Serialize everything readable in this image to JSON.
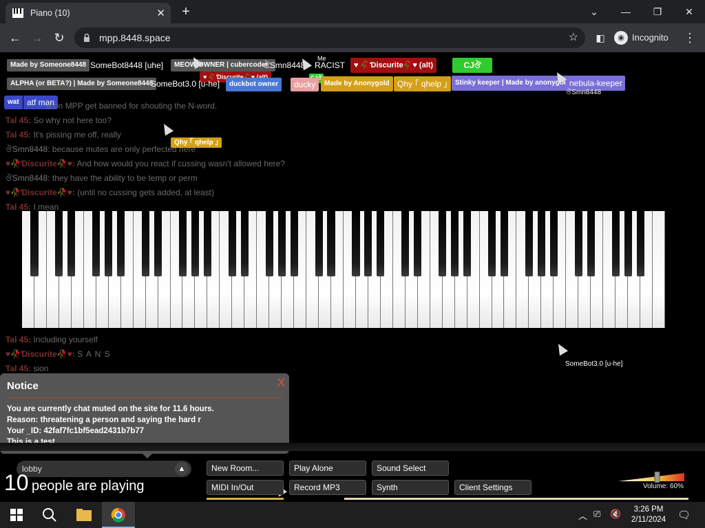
{
  "browser": {
    "tab_title": "Piano (10)",
    "tab_close": "✕",
    "new_tab": "+",
    "url": "mpp.8448.space",
    "mode_label": "Incognito",
    "controls": {
      "minimize": "—",
      "restore": "❐",
      "close": "✕",
      "dropdown": "⌄"
    },
    "nav": {
      "back": "←",
      "forward": "→",
      "reload": "↻",
      "menu": "⋮"
    }
  },
  "users": {
    "row1": [
      {
        "tag": "Made by Someone8448",
        "name": "SomeBot8448 [uhe]",
        "tag_color": "#555555"
      },
      {
        "tag": "MEOW OWNER | cubercoder_",
        "name": "ঔSmn8448",
        "tag_color": "#555555"
      },
      {
        "name": "RACIST",
        "above": "Me"
      },
      {
        "tag": "♥ 🥀Ɗiscurite🥀♥ (alt)",
        "tag_color": "#a01010"
      },
      {
        "tag": "CJঔ",
        "tag_color": "#2ecc2e"
      }
    ],
    "row2": [
      {
        "tag": "ALPHA (or BETA?) | Made by Someone8448",
        "name": "SomeBot3.0 [u-he]",
        "tag_color": "#555555"
      },
      {
        "tag": "duckbot owner",
        "name": "ducky",
        "tag_color": "#4a78d8"
      },
      {
        "tag": "Made by Anonygold",
        "name": "Qhy ｢ qhelp ｣",
        "tag_color": "#d4a017"
      },
      {
        "tag": "Stinky keeper | Made by anonygold",
        "name": "nebula-keeper",
        "tag_color": "#7a6fd8"
      }
    ],
    "row3": [
      {
        "tag": "wat",
        "name": "atf man",
        "tag_color": "#3a48c8"
      }
    ],
    "floating": [
      {
        "tag": "♥ 🥀Ɗiscurite🥀♥ (alt)"
      },
      {
        "tag": "CJঔ"
      },
      {
        "name": "ঔSmn8448"
      },
      {
        "tag": "Qhy ｢ qhelp ｣"
      },
      {
        "name": "SomeBot3.0 [u-he]"
      }
    ]
  },
  "chat": [
    {
      "who": "",
      "text": "e on MPP get banned for shouting the N-word."
    },
    {
      "who": "Tal 45:",
      "text": "So why not here too?"
    },
    {
      "who": "Tal 45:",
      "text": "It's pissing me off, really"
    },
    {
      "who": "ঔSmn8448:",
      "text": "because mutes are only perfected here"
    },
    {
      "who": "♥🥀Ɗiscurite🥀♥:",
      "text": "And how would you react if cussing wasn't allowed here?"
    },
    {
      "who": "ঔSmn8448:",
      "text": "they have the ability to be temp or perm"
    },
    {
      "who": "♥🥀Ɗiscurite🥀♥:",
      "text": "(until no cussing gets added, at least)"
    },
    {
      "who": "Tal 45:",
      "text": "I mean"
    },
    {
      "who": "Tal 45:",
      "text": "Including yourself"
    },
    {
      "who": "♥🥀Ɗiscurite🥀♥:",
      "text": "S A N S"
    },
    {
      "who": "Tal 45:",
      "text": "sion"
    }
  ],
  "notice": {
    "title": "Notice",
    "close": "X",
    "lines": [
      "You are currently chat muted on the site for 11.6 hours.",
      "Reason: threatening a person and saying the hard r",
      "Your _ID: 42faf7fc1bf5ead2431b7b77",
      "This is a test."
    ]
  },
  "controls": {
    "room": "lobby",
    "player_count": "10",
    "players_label": "people are playing",
    "buttons": [
      "New Room...",
      "Play Alone",
      "Sound Select",
      "MIDI In/Out",
      "Record MP3",
      "Synth",
      "Client Settings"
    ],
    "volume_label": "Volume: 60%",
    "volume_level": 0.6
  },
  "taskbar": {
    "time": "3:26 PM",
    "date": "2/11/2024"
  },
  "colors": {
    "chrome_dark": "#202124",
    "chrome_tab": "#35363a",
    "notice_bg": "#555555",
    "close_red": "#e0543a"
  }
}
